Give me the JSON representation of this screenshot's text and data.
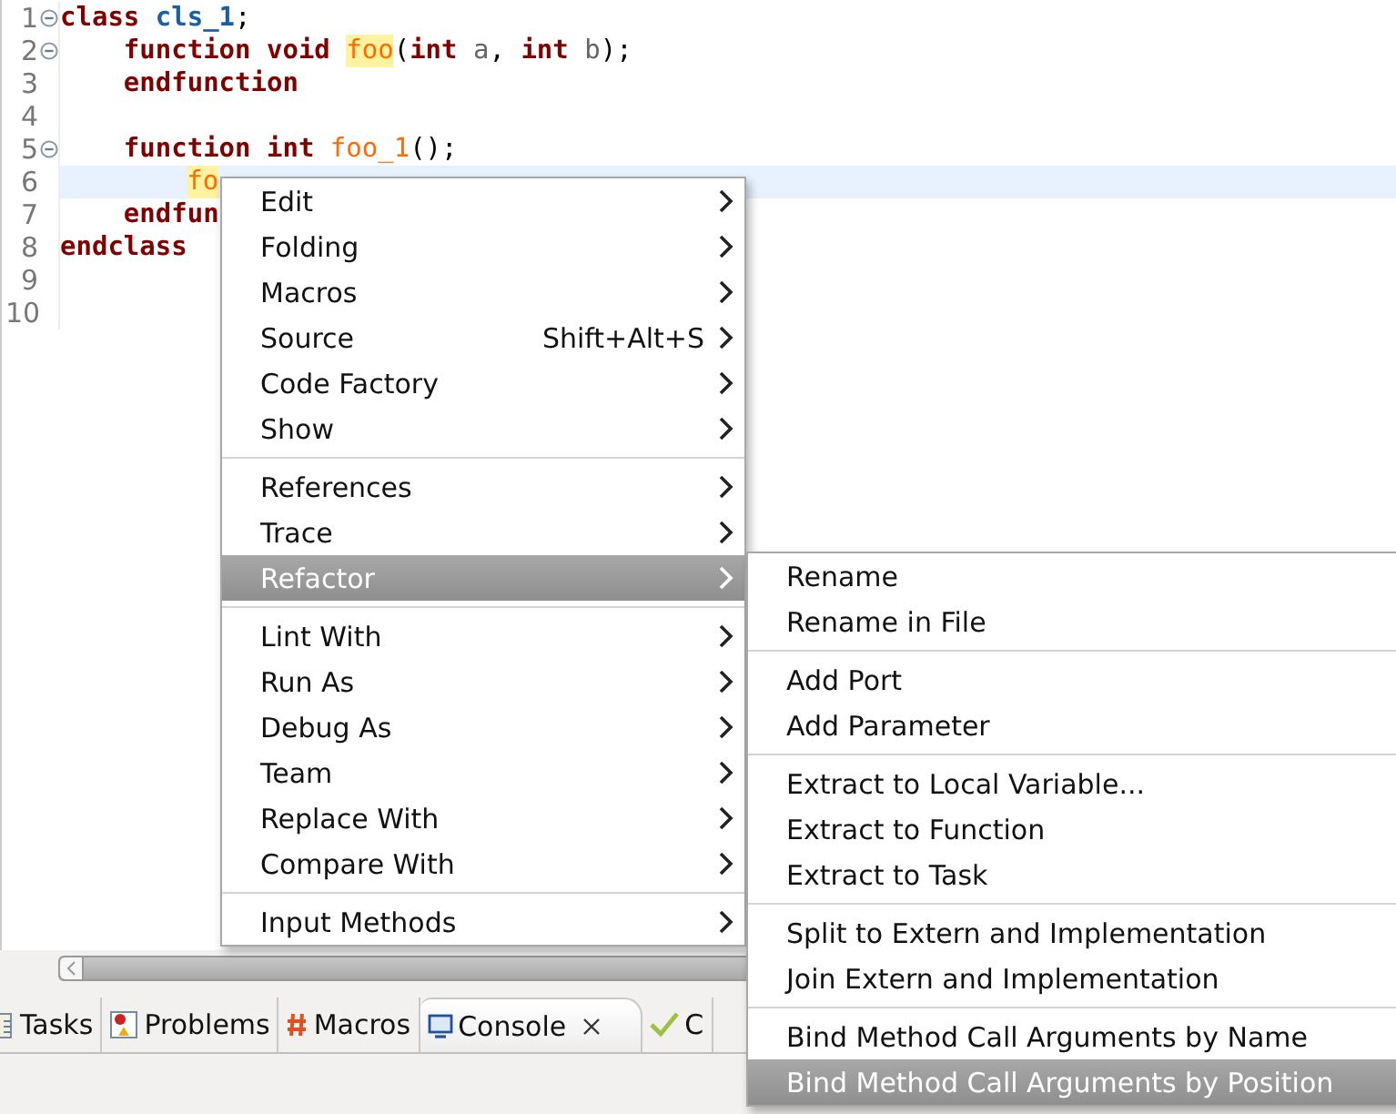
{
  "editor": {
    "lines": [
      {
        "number": "1",
        "folding": true,
        "current": false,
        "nested": false,
        "tokens": [
          {
            "text": "class ",
            "kind": "keyword"
          },
          {
            "text": "cls_1",
            "kind": "class_name"
          },
          {
            "text": ";",
            "kind": "plain"
          }
        ]
      },
      {
        "number": "2",
        "folding": true,
        "current": false,
        "nested": false,
        "tokens": [
          {
            "text": "    function void ",
            "kind": "keyword"
          },
          {
            "text": "foo",
            "kind": "marked"
          },
          {
            "text": "(",
            "kind": "plain"
          },
          {
            "text": "int ",
            "kind": "keyword"
          },
          {
            "text": "a",
            "kind": "param"
          },
          {
            "text": ", ",
            "kind": "plain"
          },
          {
            "text": "int ",
            "kind": "keyword"
          },
          {
            "text": "b",
            "kind": "param"
          },
          {
            "text": ");",
            "kind": "plain"
          }
        ]
      },
      {
        "number": "3",
        "folding": false,
        "current": false,
        "nested": false,
        "tokens": [
          {
            "text": "    endfunction",
            "kind": "keyword"
          }
        ]
      },
      {
        "number": "4",
        "folding": false,
        "current": false
      },
      {
        "number": "5",
        "folding": true,
        "current": false,
        "nested": false,
        "tokens": [
          {
            "text": "    function int ",
            "kind": "keyword"
          },
          {
            "text": "foo_1",
            "kind": "function"
          },
          {
            "text": "();",
            "kind": "plain"
          }
        ]
      },
      {
        "number": "6",
        "folding": false,
        "current": true,
        "nested": true,
        "tokens": [
          {
            "text": "fo",
            "kind": "marked"
          }
        ]
      },
      {
        "number": "7",
        "folding": false,
        "current": false,
        "nested": false,
        "tokens": [
          {
            "text": "    endfun",
            "kind": "keyword"
          }
        ]
      },
      {
        "number": "8",
        "folding": false,
        "current": false,
        "nested": false,
        "tokens": [
          {
            "text": "endclass",
            "kind": "keyword"
          }
        ]
      },
      {
        "number": "9",
        "folding": false,
        "current": false
      },
      {
        "number": "10",
        "folding": false,
        "current": false
      }
    ]
  },
  "context_menu": {
    "groups": [
      [
        {
          "label": "Edit",
          "selected": false
        },
        {
          "label": "Folding",
          "selected": false
        },
        {
          "label": "Macros",
          "selected": false
        },
        {
          "label": "Source",
          "shortcut": "Shift+Alt+S",
          "selected": false
        },
        {
          "label": "Code Factory",
          "selected": false
        },
        {
          "label": "Show",
          "selected": false
        }
      ],
      [
        {
          "label": "References",
          "selected": false
        },
        {
          "label": "Trace",
          "selected": false
        },
        {
          "label": "Refactor",
          "selected": true
        }
      ],
      [
        {
          "label": "Lint With",
          "selected": false
        },
        {
          "label": "Run As",
          "selected": false
        },
        {
          "label": "Debug As",
          "selected": false
        },
        {
          "label": "Team",
          "selected": false
        },
        {
          "label": "Replace With",
          "selected": false
        },
        {
          "label": "Compare With",
          "selected": false
        }
      ],
      [
        {
          "label": "Input Methods",
          "selected": false
        }
      ]
    ]
  },
  "submenu": {
    "groups": [
      [
        {
          "label": "Rename",
          "selected": false
        },
        {
          "label": "Rename in File",
          "selected": false
        }
      ],
      [
        {
          "label": "Add Port",
          "selected": false
        },
        {
          "label": "Add Parameter",
          "selected": false
        }
      ],
      [
        {
          "label": "Extract to Local Variable...",
          "selected": false
        },
        {
          "label": "Extract to Function",
          "selected": false
        },
        {
          "label": "Extract to Task",
          "selected": false
        }
      ],
      [
        {
          "label": "Split to Extern and Implementation",
          "selected": false
        },
        {
          "label": "Join Extern and Implementation",
          "selected": false
        }
      ],
      [
        {
          "label": "Bind Method Call Arguments by Name",
          "selected": false
        },
        {
          "label": "Bind Method Call Arguments by Position",
          "selected": true
        }
      ]
    ]
  },
  "view_tabs": [
    {
      "label": "Tasks",
      "kind": "tasks",
      "selected": false,
      "closable": false
    },
    {
      "label": "Problems",
      "kind": "problems",
      "selected": false,
      "closable": false
    },
    {
      "label": "Macros",
      "kind": "macros",
      "selected": false,
      "closable": false
    },
    {
      "label": "Console",
      "kind": "console",
      "selected": true,
      "closable": true
    },
    {
      "label": "C",
      "kind": "check",
      "selected": false,
      "closable": false
    }
  ]
}
